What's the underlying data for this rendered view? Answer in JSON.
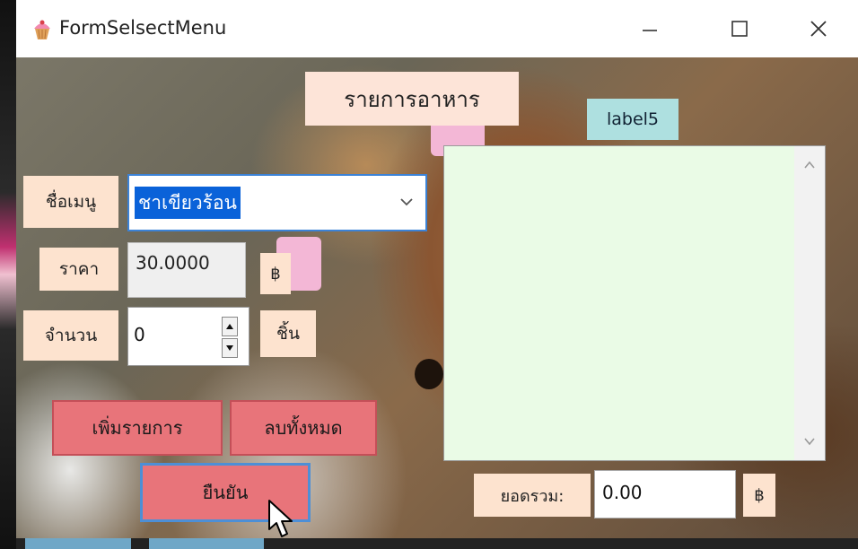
{
  "window": {
    "title": "FormSelsectMenu"
  },
  "labels": {
    "heading": "รายการอาหาร",
    "label5": "label5",
    "menu_name": "ชื่อเมนู",
    "price": "ราคา",
    "quantity": "จำนวน",
    "baht_symbol": "฿",
    "unit": "ชิ้น",
    "total": "ยอดรวม:"
  },
  "inputs": {
    "menu_selected": "ชาเขียวร้อน",
    "price_value": "30.0000",
    "quantity_value": "0",
    "total_value": "0.00"
  },
  "buttons": {
    "add": "เพิ่มรายการ",
    "clear": "ลบทั้งหมด",
    "confirm": "ยืนยัน"
  },
  "listbox": {
    "items": []
  },
  "colors": {
    "label_bg": "#fde3cf",
    "button_bg": "#e8747a",
    "listbox_bg": "#eafbe6",
    "label5_bg": "#aee0e0",
    "selection": "#0a62d9"
  }
}
